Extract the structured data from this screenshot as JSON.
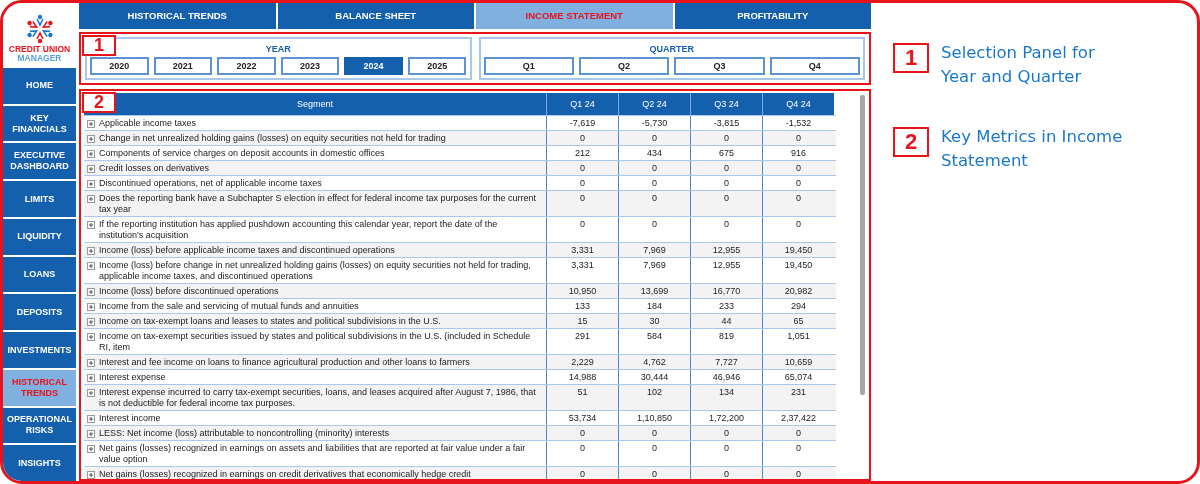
{
  "sidebar": {
    "logo": {
      "line1": "CREDIT UNION",
      "line2": "MANAGER"
    },
    "items": [
      {
        "label": "HOME",
        "selected": false
      },
      {
        "label": "KEY FINANCIALS",
        "selected": false
      },
      {
        "label": "EXECUTIVE DASHBOARD",
        "selected": false
      },
      {
        "label": "LIMITS",
        "selected": false
      },
      {
        "label": "LIQUIDITY",
        "selected": false
      },
      {
        "label": "LOANS",
        "selected": false
      },
      {
        "label": "DEPOSITS",
        "selected": false
      },
      {
        "label": "INVESTMENTS",
        "selected": false
      },
      {
        "label": "HISTORICAL TRENDS",
        "selected": true
      },
      {
        "label": "OPERATIONAL RISKS",
        "selected": false
      },
      {
        "label": "INSIGHTS",
        "selected": false
      }
    ]
  },
  "tabs": [
    {
      "label": "HISTORICAL TRENDS",
      "selected": false
    },
    {
      "label": "BALANCE SHEET",
      "selected": false
    },
    {
      "label": "INCOME STATEMENT",
      "selected": true
    },
    {
      "label": "PROFITABILITY",
      "selected": false
    }
  ],
  "selection_panel": {
    "badge": "1",
    "year": {
      "title": "YEAR",
      "options": [
        {
          "label": "2020",
          "selected": false
        },
        {
          "label": "2021",
          "selected": false
        },
        {
          "label": "2022",
          "selected": false
        },
        {
          "label": "2023",
          "selected": false
        },
        {
          "label": "2024",
          "selected": true
        },
        {
          "label": "2025",
          "selected": false
        }
      ]
    },
    "quarter": {
      "title": "QUARTER",
      "options": [
        {
          "label": "Q1",
          "selected": false
        },
        {
          "label": "Q2",
          "selected": false
        },
        {
          "label": "Q3",
          "selected": false
        },
        {
          "label": "Q4",
          "selected": false
        }
      ]
    }
  },
  "table": {
    "badge": "2",
    "columns": [
      "Segment",
      "Q1 24",
      "Q2 24",
      "Q3 24",
      "Q4 24"
    ],
    "rows": [
      {
        "segment": "Applicable income taxes",
        "values": [
          "-7,619",
          "-5,730",
          "-3,815",
          "-1,532"
        ]
      },
      {
        "segment": "Change in net unrealized holding gains (losses) on equity securities not held for trading",
        "values": [
          "0",
          "0",
          "0",
          "0"
        ]
      },
      {
        "segment": "Components of service charges on deposit accounts in domestic offices",
        "values": [
          "212",
          "434",
          "675",
          "916"
        ]
      },
      {
        "segment": "Credit losses on derivatives",
        "values": [
          "0",
          "0",
          "0",
          "0"
        ]
      },
      {
        "segment": "Discontinued operations, net of applicable income taxes",
        "values": [
          "0",
          "0",
          "0",
          "0"
        ]
      },
      {
        "segment": "Does the reporting bank have a Subchapter S election in effect for federal income tax purposes for the current tax year",
        "values": [
          "0",
          "0",
          "0",
          "0"
        ]
      },
      {
        "segment": "If the reporting institution has applied pushdown accounting this calendar year, report the date of the institution's acquisition",
        "values": [
          "0",
          "0",
          "0",
          "0"
        ]
      },
      {
        "segment": "Income (loss) before applicable income taxes and discontinued operations",
        "values": [
          "3,331",
          "7,969",
          "12,955",
          "19,450"
        ]
      },
      {
        "segment": "Income (loss) before change in net unrealized holding gains (losses) on equity securities not held for trading, applicable income taxes, and discontinued operations",
        "values": [
          "3,331",
          "7,969",
          "12,955",
          "19,450"
        ]
      },
      {
        "segment": "Income (loss) before discontinued operations",
        "values": [
          "10,950",
          "13,699",
          "16,770",
          "20,982"
        ]
      },
      {
        "segment": "Income from the sale and servicing of mutual funds and annuities",
        "values": [
          "133",
          "184",
          "233",
          "294"
        ]
      },
      {
        "segment": "Income on tax-exempt loans and leases to states and political subdivisions in the U.S.",
        "values": [
          "15",
          "30",
          "44",
          "65"
        ]
      },
      {
        "segment": "Income on tax-exempt securities issued by states and political subdivisions in the U.S. (included in Schedule RI, item",
        "values": [
          "291",
          "584",
          "819",
          "1,051"
        ]
      },
      {
        "segment": "Interest and fee income on loans to finance agricultural production and other loans to farmers",
        "values": [
          "2,229",
          "4,762",
          "7,727",
          "10,659"
        ]
      },
      {
        "segment": "Interest expense",
        "values": [
          "14,988",
          "30,444",
          "46,946",
          "65,074"
        ]
      },
      {
        "segment": "Interest expense incurred to carry tax-exempt securities, loans, and leases acquired after August 7, 1986, that is not deductible for federal income tax purposes.",
        "values": [
          "51",
          "102",
          "134",
          "231"
        ]
      },
      {
        "segment": "Interest income",
        "values": [
          "53,734",
          "1,10,850",
          "1,72,200",
          "2,37,422"
        ]
      },
      {
        "segment": "LESS: Net income (loss) attributable to noncontrolling (minority) interests",
        "values": [
          "0",
          "0",
          "0",
          "0"
        ]
      },
      {
        "segment": "Net gains (losses) recognized in earnings on assets and liabilities that are reported at fair value under a fair value option",
        "values": [
          "0",
          "0",
          "0",
          "0"
        ]
      },
      {
        "segment": "Net gains (losses) recognized in earnings on credit derivatives that economically hedge credit",
        "values": [
          "0",
          "0",
          "0",
          "0"
        ]
      }
    ]
  },
  "annotations": [
    {
      "number": "1",
      "text": "Selection Panel for Year and Quarter"
    },
    {
      "number": "2",
      "text": "Key Metrics in Income Statement"
    }
  ]
}
